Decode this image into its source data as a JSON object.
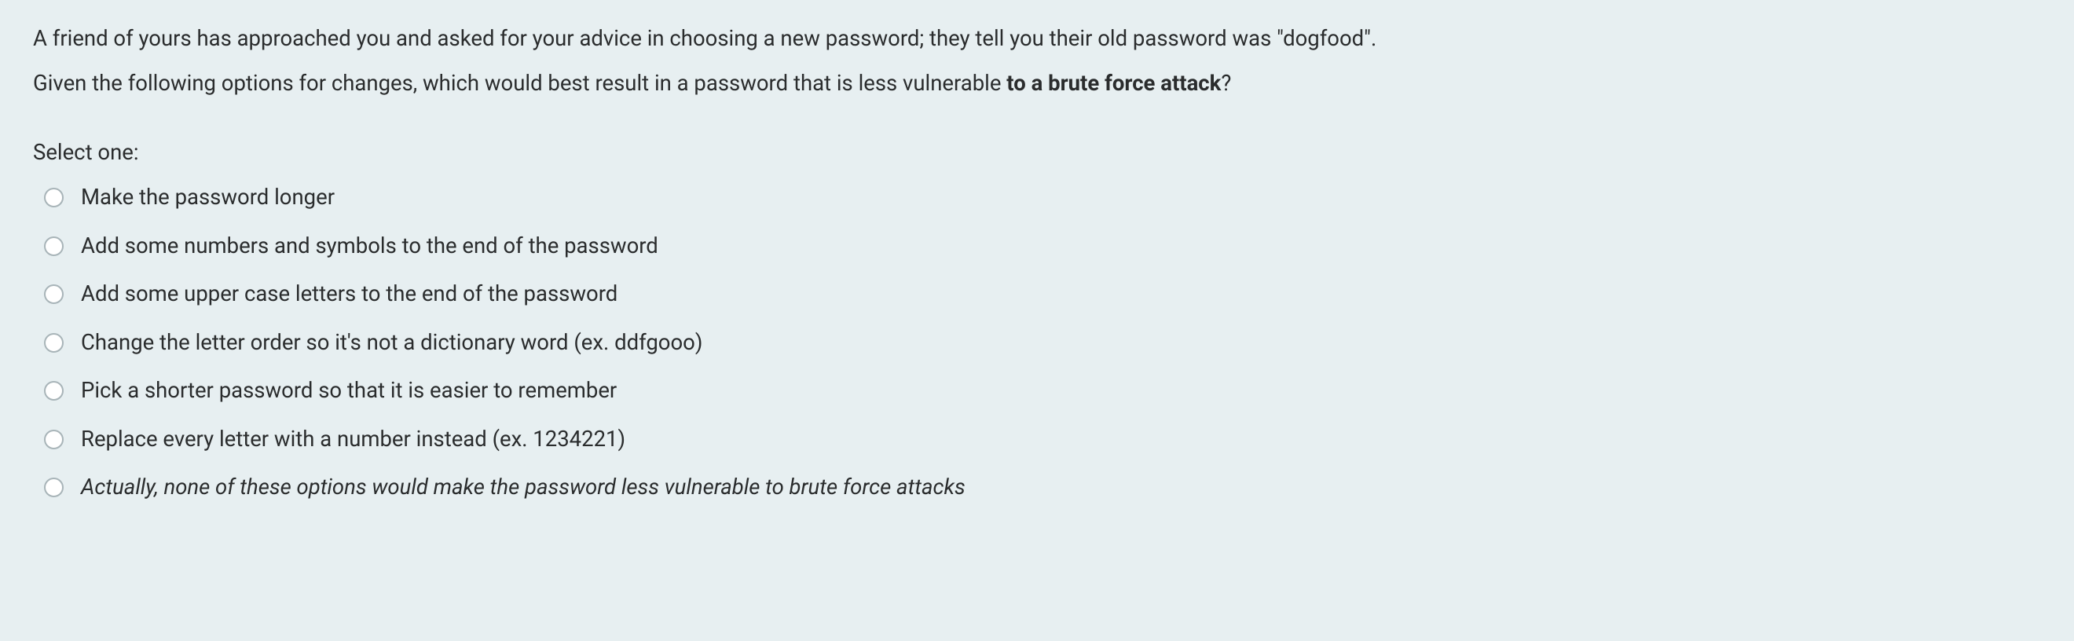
{
  "question": {
    "paragraph1": "A friend of yours has approached you and asked for your advice in choosing a new password; they tell you their old password was \"dogfood\".",
    "paragraph2_before": "Given the following options for changes, which would best result in a password that is less vulnerable ",
    "paragraph2_bold": "to a brute force attack",
    "paragraph2_after": "?"
  },
  "selectLabel": "Select one:",
  "options": [
    {
      "text": "Make the password longer",
      "italic": false
    },
    {
      "text": "Add some numbers and symbols to the end of the password",
      "italic": false
    },
    {
      "text": "Add some upper case letters to the end of the password",
      "italic": false
    },
    {
      "text": "Change the letter order so it's not a dictionary word (ex. ddfgooo)",
      "italic": false
    },
    {
      "text": "Pick a shorter password so that it is easier to remember",
      "italic": false
    },
    {
      "text": "Replace every letter with a number instead (ex. 1234221)",
      "italic": false
    },
    {
      "text": "Actually, none of these options would make the password less vulnerable to brute force attacks",
      "italic": true
    }
  ]
}
